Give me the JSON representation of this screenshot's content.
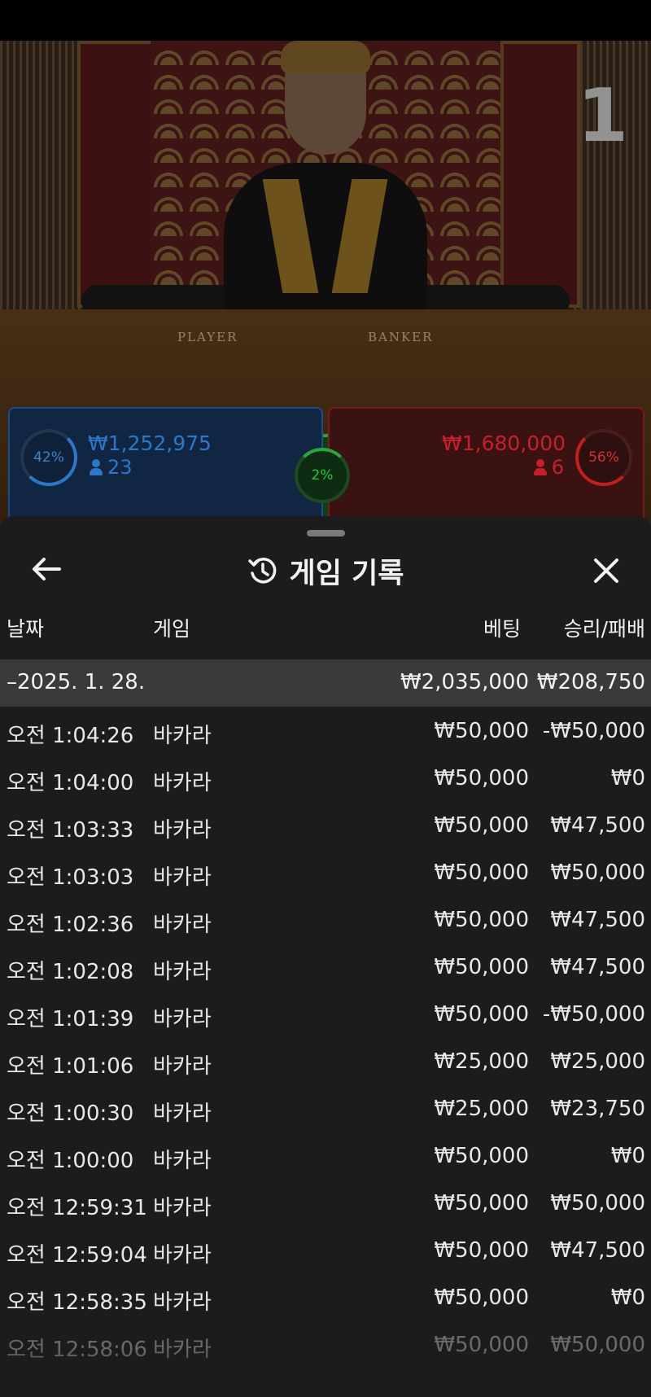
{
  "video": {
    "table_labels": [
      "PLAYER",
      "BANKER"
    ],
    "round_number": "1"
  },
  "bets": {
    "player": {
      "percent": "42%",
      "amount": "₩1,252,975",
      "count": "23",
      "color": "#2d77c8"
    },
    "banker": {
      "percent": "56%",
      "amount": "₩1,680,000",
      "count": "6",
      "color": "#c8202a"
    },
    "tie": {
      "percent": "2%",
      "color": "#2bc443"
    }
  },
  "sheet": {
    "title": "게임 기록",
    "icons": {
      "back": "arrow-left-icon",
      "history": "history-icon",
      "close": "close-icon"
    },
    "columns": {
      "date": "날짜",
      "game": "게임",
      "bet": "베팅",
      "win_loss": "승리/패배"
    },
    "summary": {
      "date": "–2025. 1. 28.",
      "bet": "₩2,035,000",
      "win_loss": "₩208,750"
    },
    "rows": [
      {
        "time": "오전 1:04:26",
        "game": "바카라",
        "bet": "₩50,000",
        "win_loss": "-₩50,000"
      },
      {
        "time": "오전 1:04:00",
        "game": "바카라",
        "bet": "₩50,000",
        "win_loss": "₩0"
      },
      {
        "time": "오전 1:03:33",
        "game": "바카라",
        "bet": "₩50,000",
        "win_loss": "₩47,500"
      },
      {
        "time": "오전 1:03:03",
        "game": "바카라",
        "bet": "₩50,000",
        "win_loss": "₩50,000"
      },
      {
        "time": "오전 1:02:36",
        "game": "바카라",
        "bet": "₩50,000",
        "win_loss": "₩47,500"
      },
      {
        "time": "오전 1:02:08",
        "game": "바카라",
        "bet": "₩50,000",
        "win_loss": "₩47,500"
      },
      {
        "time": "오전 1:01:39",
        "game": "바카라",
        "bet": "₩50,000",
        "win_loss": "-₩50,000"
      },
      {
        "time": "오전 1:01:06",
        "game": "바카라",
        "bet": "₩25,000",
        "win_loss": "₩25,000"
      },
      {
        "time": "오전 1:00:30",
        "game": "바카라",
        "bet": "₩25,000",
        "win_loss": "₩23,750"
      },
      {
        "time": "오전 1:00:00",
        "game": "바카라",
        "bet": "₩50,000",
        "win_loss": "₩0"
      },
      {
        "time": "오전 12:59:31",
        "game": "바카라",
        "bet": "₩50,000",
        "win_loss": "₩50,000"
      },
      {
        "time": "오전 12:59:04",
        "game": "바카라",
        "bet": "₩50,000",
        "win_loss": "₩47,500"
      },
      {
        "time": "오전 12:58:35",
        "game": "바카라",
        "bet": "₩50,000",
        "win_loss": "₩0"
      },
      {
        "time": "오전 12:58:06",
        "game": "바카라",
        "bet": "₩50,000",
        "win_loss": "₩50,000"
      }
    ]
  }
}
